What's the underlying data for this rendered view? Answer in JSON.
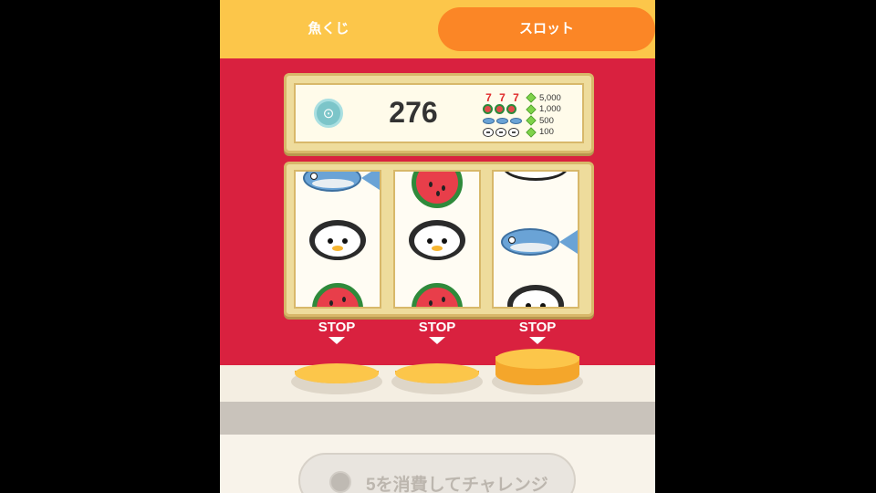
{
  "tabs": [
    {
      "label": "魚くじ",
      "active": false
    },
    {
      "label": "スロット",
      "active": true
    }
  ],
  "coin_icon": "fish-coin-icon",
  "balance": "276",
  "paytable": [
    {
      "symbol": "seven",
      "reward": "5,000"
    },
    {
      "symbol": "watermelon",
      "reward": "1,000"
    },
    {
      "symbol": "fish",
      "reward": "500"
    },
    {
      "symbol": "penguin",
      "reward": "100"
    }
  ],
  "reels": [
    [
      "fish",
      "penguin",
      "watermelon"
    ],
    [
      "watermelon",
      "penguin",
      "watermelon"
    ],
    [
      "ring",
      "fish",
      "penguin"
    ]
  ],
  "stop_buttons": [
    "STOP",
    "STOP",
    "STOP"
  ],
  "challenge_button": {
    "label": "5を消費してチャレンジ",
    "enabled": false
  },
  "colors": {
    "accent": "#fb8626",
    "tabbar": "#fcc64a",
    "machine": "#d9213f"
  }
}
